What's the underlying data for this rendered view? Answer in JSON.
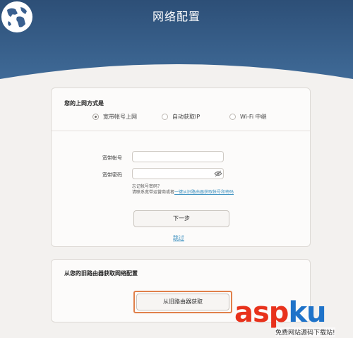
{
  "header": {
    "title": "网络配置",
    "colors": {
      "top": "#2d4f77",
      "bottom": "#3f6a97"
    },
    "icon": "globe-icon"
  },
  "connection": {
    "section_label": "您的上网方式是",
    "options": [
      {
        "label": "宽带帐号上网",
        "checked": true
      },
      {
        "label": "自动获取IP",
        "checked": false
      },
      {
        "label": "Wi-Fi 中继",
        "checked": false
      }
    ]
  },
  "form": {
    "account_label": "宽带帐号",
    "account_value": "",
    "password_label": "宽带密码",
    "password_value": "",
    "password_icon": "eye-icon",
    "hint_line1": "忘记帐号密码？",
    "hint_line2_prefix": "请联系宽带运营商或者",
    "hint_line2_link": "一键从旧路由器获取帐号和密码",
    "next_label": "下一步",
    "skip_label": "跳过"
  },
  "old_router": {
    "section_label": "从您的旧路由器获取网络配置",
    "button_label": "从旧路由器获取",
    "highlight_color": "#e0804a"
  },
  "watermark": {
    "brand_prefix": "asp",
    "brand_accent": "ku",
    "subtitle": "免费网站源码下载站!"
  }
}
